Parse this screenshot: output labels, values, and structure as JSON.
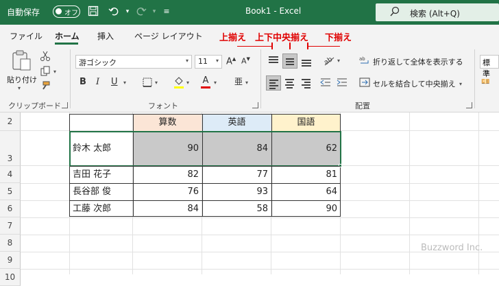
{
  "titlebar": {
    "autosave_label": "自動保存",
    "autosave_state": "オフ",
    "doc_title": "Book1  -  Excel",
    "search_placeholder": "検索 (Alt+Q)",
    "color": "#217346"
  },
  "tabs": [
    {
      "label": "ファイル",
      "active": false
    },
    {
      "label": "ホーム",
      "active": true
    },
    {
      "label": "挿入",
      "active": false
    },
    {
      "label": "ページ レイアウト",
      "active": false
    }
  ],
  "ribbon": {
    "clipboard": {
      "paste_label": "貼り付け",
      "group_label": "クリップボード"
    },
    "font": {
      "font_name": "游ゴシック",
      "font_size": "11",
      "bold": "B",
      "italic": "I",
      "underline": "U",
      "font_color_glyph": "A",
      "group_label": "フォント"
    },
    "alignment": {
      "wrap_text": "折り返して全体を表示する",
      "merge_center": "セルを結合して中央揃え",
      "group_label": "配置",
      "selected_vertical": "middle"
    },
    "number_format": "標準",
    "callouts": [
      "上揃え",
      "上下中央揃え",
      "下揃え"
    ]
  },
  "sheet": {
    "row_numbers": [
      "2",
      "3",
      "4",
      "5",
      "6",
      "7",
      "8",
      "9",
      "10"
    ],
    "headers": [
      "算数",
      "英語",
      "国語"
    ],
    "header_colors": [
      "#fbe5d6",
      "#ddebf7",
      "#fff2cc"
    ],
    "rows": [
      {
        "name": "鈴木 太郎",
        "values": [
          "90",
          "84",
          "62"
        ]
      },
      {
        "name": "吉田 花子",
        "values": [
          "82",
          "77",
          "81"
        ]
      },
      {
        "name": "長谷部 俊",
        "values": [
          "76",
          "93",
          "64"
        ]
      },
      {
        "name": "工藤 次郎",
        "values": [
          "84",
          "58",
          "90"
        ]
      }
    ],
    "selected_fill": "#c9c9c9",
    "watermark": "Buzzword Inc."
  }
}
